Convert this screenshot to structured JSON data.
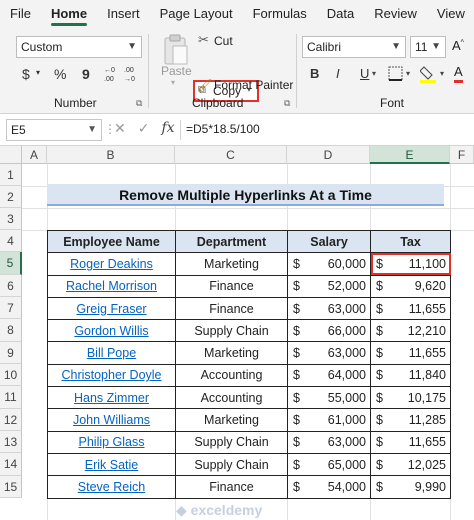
{
  "menu": [
    "File",
    "Home",
    "Insert",
    "Page Layout",
    "Formulas",
    "Data",
    "Review",
    "View"
  ],
  "ribbon": {
    "number_format": "Custom",
    "number_label": "Number",
    "currency_symbol": "$",
    "percent_symbol": "%",
    "comma_symbol": "9",
    "cut_label": "Cut",
    "copy_label": "Copy",
    "paste_label": "Paste",
    "format_painter_label": "Format Painter",
    "clipboard_label": "Clipboard",
    "font_name": "Calibri",
    "font_size": "11",
    "font_label": "Font",
    "bold": "B",
    "italic": "I",
    "underline": "U"
  },
  "formula_bar": {
    "name_box": "E5",
    "fx": "fx",
    "formula": "=D5*18.5/100"
  },
  "columns": [
    "A",
    "B",
    "C",
    "D",
    "E",
    "F"
  ],
  "rows": [
    "1",
    "2",
    "3",
    "4",
    "5",
    "6",
    "7",
    "8",
    "9",
    "10",
    "11",
    "12",
    "13",
    "14",
    "15"
  ],
  "sheet_title": "Remove Multiple Hyperlinks At a Time",
  "table": {
    "headers": [
      "Employee Name",
      "Department",
      "Salary",
      "Tax"
    ],
    "rows": [
      {
        "name": "Roger Deakins",
        "dept": "Marketing",
        "salary": "60,000",
        "tax": "11,100"
      },
      {
        "name": "Rachel Morrison",
        "dept": "Finance",
        "salary": "52,000",
        "tax": "9,620"
      },
      {
        "name": "Greig Fraser",
        "dept": "Finance",
        "salary": "63,000",
        "tax": "11,655"
      },
      {
        "name": "Gordon Willis",
        "dept": "Supply Chain",
        "salary": "66,000",
        "tax": "12,210"
      },
      {
        "name": "Bill Pope",
        "dept": "Marketing",
        "salary": "63,000",
        "tax": "11,655"
      },
      {
        "name": "Christopher Doyle",
        "dept": "Accounting",
        "salary": "64,000",
        "tax": "11,840"
      },
      {
        "name": "Hans Zimmer",
        "dept": "Accounting",
        "salary": "55,000",
        "tax": "10,175"
      },
      {
        "name": "John Williams",
        "dept": "Marketing",
        "salary": "61,000",
        "tax": "11,285"
      },
      {
        "name": "Philip Glass",
        "dept": "Supply Chain",
        "salary": "63,000",
        "tax": "11,655"
      },
      {
        "name": "Erik Satie",
        "dept": "Supply Chain",
        "salary": "65,000",
        "tax": "12,025"
      },
      {
        "name": "Steve Reich",
        "dept": "Finance",
        "salary": "54,000",
        "tax": "9,990"
      }
    ],
    "currency": "$"
  },
  "watermark": "exceldemy",
  "colors": {
    "accent": "#217346",
    "highlight": "#e0322b",
    "header_fill": "#dbe5f1",
    "link": "#0563c1"
  }
}
